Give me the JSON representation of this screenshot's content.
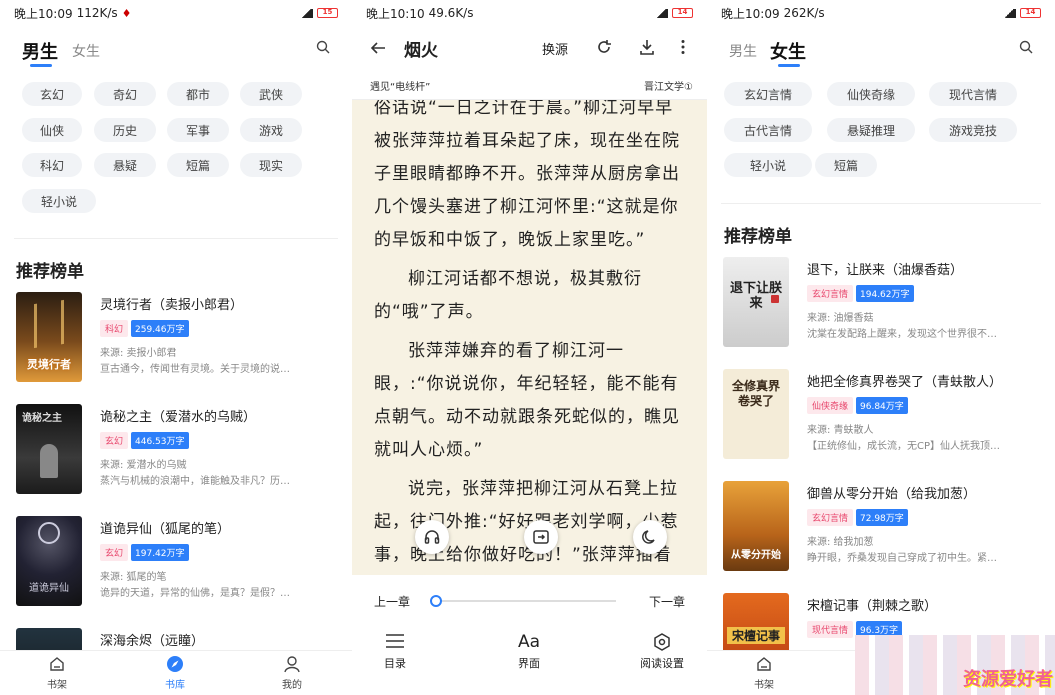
{
  "panel1": {
    "status": {
      "time": "晚上10:09",
      "speed": "112K/s",
      "battery": "15"
    },
    "gender_tabs": [
      "男生",
      "女生"
    ],
    "tags": [
      "玄幻",
      "奇幻",
      "都市",
      "武侠",
      "仙侠",
      "历史",
      "军事",
      "游戏",
      "科幻",
      "悬疑",
      "短篇",
      "现实",
      "轻小说"
    ],
    "section_title": "推荐榜单",
    "books": [
      {
        "title": "灵境行者（卖报小郎君）",
        "category": "科幻",
        "popularity": "259.46万字",
        "source": "来源: 卖报小郎君",
        "desc": "亘古通今，传闻世有灵境。关于灵境的说…",
        "cover_text": "灵境行者"
      },
      {
        "title": "诡秘之主（爱潜水的乌贼）",
        "category": "玄幻",
        "popularity": "446.53万字",
        "source": "来源: 爱潜水的乌贼",
        "desc": "蒸汽与机械的浪潮中，谁能触及非凡？历…",
        "cover_text": "诡秘之主"
      },
      {
        "title": "道诡异仙（狐尾的笔）",
        "category": "玄幻",
        "popularity": "197.42万字",
        "source": "来源: 狐尾的笔",
        "desc": "诡异的天道，异常的仙佛，是真？是假？…",
        "cover_text": "道诡异仙"
      },
      {
        "title": "深海余烬（远瞳）",
        "category": "",
        "popularity": "",
        "source": "",
        "desc": "",
        "cover_text": ""
      }
    ],
    "nav": [
      "书架",
      "书库",
      "我的"
    ]
  },
  "panel2": {
    "status": {
      "time": "晚上10:10",
      "speed": "49.6K/s",
      "battery": "14"
    },
    "book_title": "烟火",
    "change_source": "换源",
    "chapter": "遇见“电线杆”",
    "source_site": "晋江文学①",
    "paragraphs": [
      "俗话说“一日之计在于晨。”柳江河早早被张萍萍拉着耳朵起了床，现在坐在院子里眼睛都睁不开。张萍萍从厨房拿出几个馒头塞进了柳江河怀里:“这就是你的早饭和中饭了，晚饭上家里吃。”",
      "柳江河话都不想说，极其敷衍的“哦”了声。",
      "张萍萍嫌弃的看了柳江河一眼，:“你说说你，年纪轻轻，能不能有点朝气。动不动就跟条死蛇似的，瞧见就叫人心烦。”",
      "说完，张萍萍把柳江河从石凳上拉起，往门外推:“好好跟老刘学啊，少惹事，晚上给你做好吃的！”张萍萍插着腰“行了，去吧！”"
    ],
    "prev_chapter": "上一章",
    "next_chapter": "下一章",
    "progress": 0.0,
    "menu": [
      "目录",
      "界面",
      "阅读设置"
    ]
  },
  "panel3": {
    "status": {
      "time": "晚上10:09",
      "speed": "262K/s",
      "battery": "14"
    },
    "gender_tabs": [
      "男生",
      "女生"
    ],
    "tags": [
      "玄幻言情",
      "仙侠奇缘",
      "现代言情",
      "古代言情",
      "悬疑推理",
      "游戏竞技",
      "轻小说",
      "短篇"
    ],
    "section_title": "推荐榜单",
    "books": [
      {
        "title": "退下，让朕来（油爆香菇）",
        "category": "玄幻言情",
        "popularity": "194.62万字",
        "source": "来源: 油爆香菇",
        "desc": "沈棠在发配路上醒来，发现这个世界很不…",
        "cover_text": "退下让朕来"
      },
      {
        "title": "她把全修真界卷哭了（青蚨散人）",
        "category": "仙侠奇缘",
        "popularity": "96.84万字",
        "source": "来源: 青蚨散人",
        "desc": "【正统修仙，成长流，无CP】仙人抚我顶…",
        "cover_text": "全修真界卷哭了"
      },
      {
        "title": "御兽从零分开始（给我加葱）",
        "category": "玄幻言情",
        "popularity": "72.98万字",
        "source": "来源: 给我加葱",
        "desc": "睁开眼，乔桑发现自己穿成了初中生。紧…",
        "cover_text": "从零分开始"
      },
      {
        "title": "宋檀记事（荆棘之歌）",
        "category": "现代言情",
        "popularity": "96.3万字",
        "source": "",
        "desc": "",
        "cover_text": "宋檀记事"
      }
    ],
    "nav": [
      "书架"
    ],
    "watermark": "资源爱好者"
  }
}
